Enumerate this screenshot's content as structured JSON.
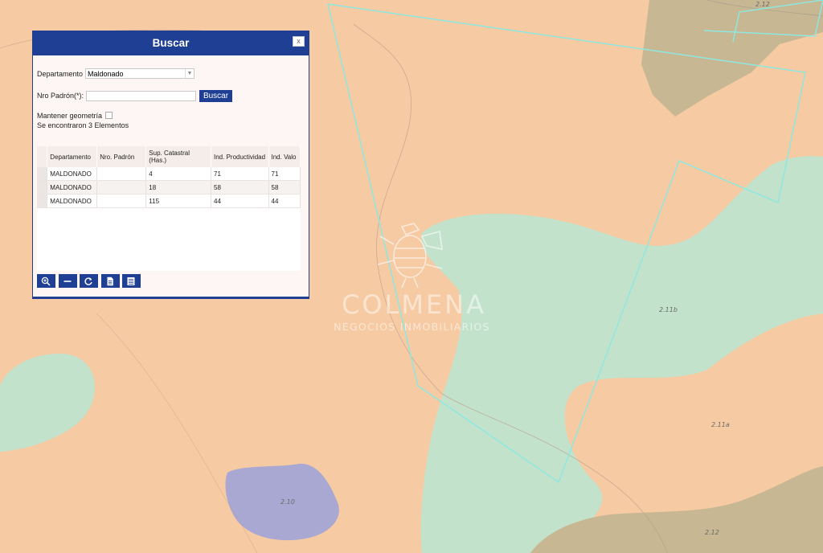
{
  "dialog": {
    "title": "Buscar",
    "close_label": "x",
    "departamento_label": "Departamento",
    "departamento_value": "Maldonado",
    "padron_label": "Nro Padrón(*):",
    "padron_value": "",
    "search_button": "Buscar",
    "keep_geometry_label": "Mantener geometría",
    "keep_geometry_checked": false,
    "result_text": "Se encontraron 3 Elementos"
  },
  "grid": {
    "columns": [
      "Departamento",
      "Nro. Padrón",
      "Sup. Catastral (Has.)",
      "Ind. Productividad",
      "Ind. Valo"
    ],
    "rows": [
      [
        "MALDONADO",
        "",
        "4",
        "71",
        "71"
      ],
      [
        "MALDONADO",
        "",
        "18",
        "58",
        "58"
      ],
      [
        "MALDONADO",
        "",
        "115",
        "44",
        "44"
      ]
    ]
  },
  "toolbar": {
    "buttons": [
      "zoom-in-icon",
      "minus-icon",
      "refresh-icon",
      "document-icon",
      "table-icon"
    ]
  },
  "map": {
    "labels": [
      "2.12",
      "2.11b",
      "2.11a",
      "2.10",
      "2.12"
    ]
  },
  "watermark": {
    "name": "COLMENA",
    "subtitle": "NEGOCIOS INMOBILIARIOS"
  },
  "colors": {
    "accent": "#1e3f94",
    "map_peach": "#f6caa3",
    "map_green": "#c3e2cb",
    "map_olive": "#c7b792",
    "map_lilac": "#a8a8d2",
    "parcel_outline": "#8ee8e0"
  }
}
